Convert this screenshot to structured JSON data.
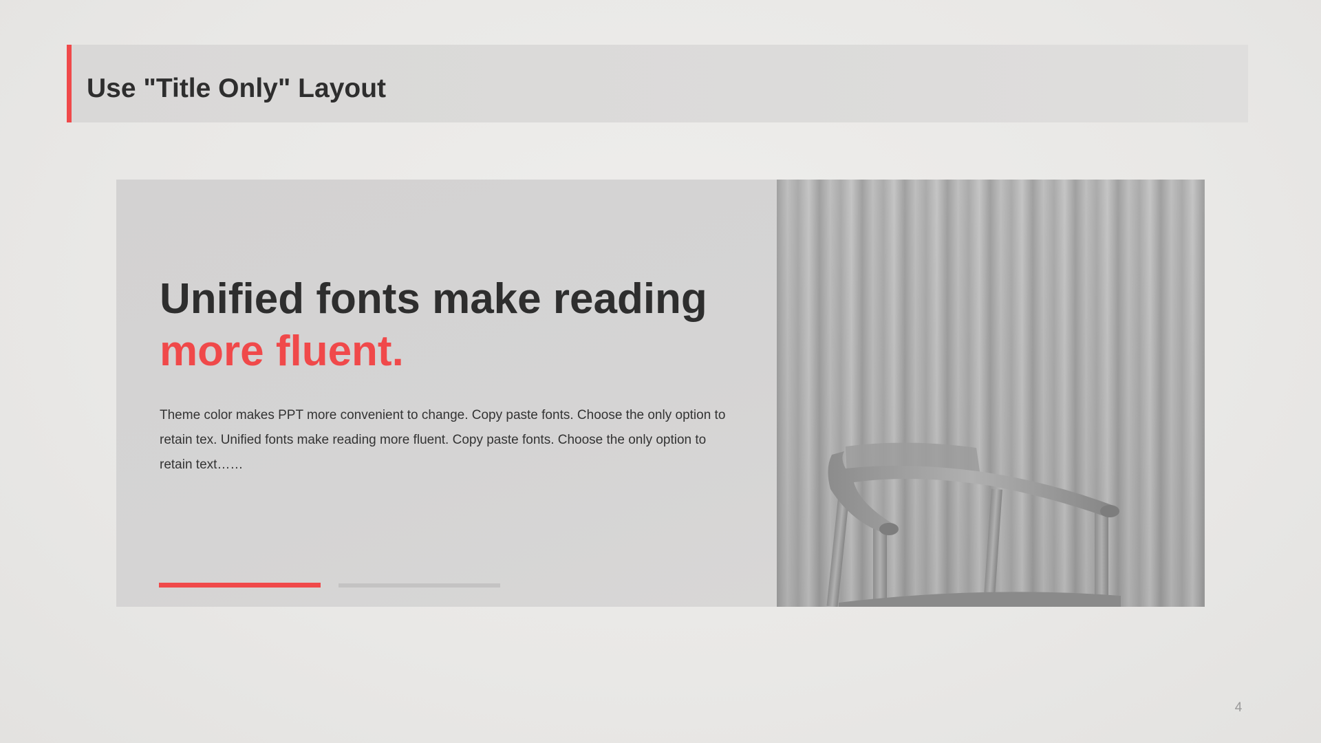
{
  "slide": {
    "title": "Use \"Title Only\" Layout",
    "page_number": "4"
  },
  "content": {
    "headline_line1": "Unified fonts make reading",
    "headline_line2": "more fluent.",
    "body": "Theme color makes PPT more convenient to change. Copy paste fonts. Choose the only option to retain tex. Unified fonts make reading more fluent. Copy paste fonts. Choose the only option to retain text……"
  },
  "slider": {
    "active_index": 0,
    "count": 2
  },
  "colors": {
    "accent": "#f0494a",
    "title_text": "#2e2e2e",
    "panel_bg": "#d4d3d3",
    "title_bar_bg": "#dbdad9",
    "inactive_bar": "#c4c3c3"
  },
  "icons": {
    "photo": "chair-curtain-photo"
  }
}
